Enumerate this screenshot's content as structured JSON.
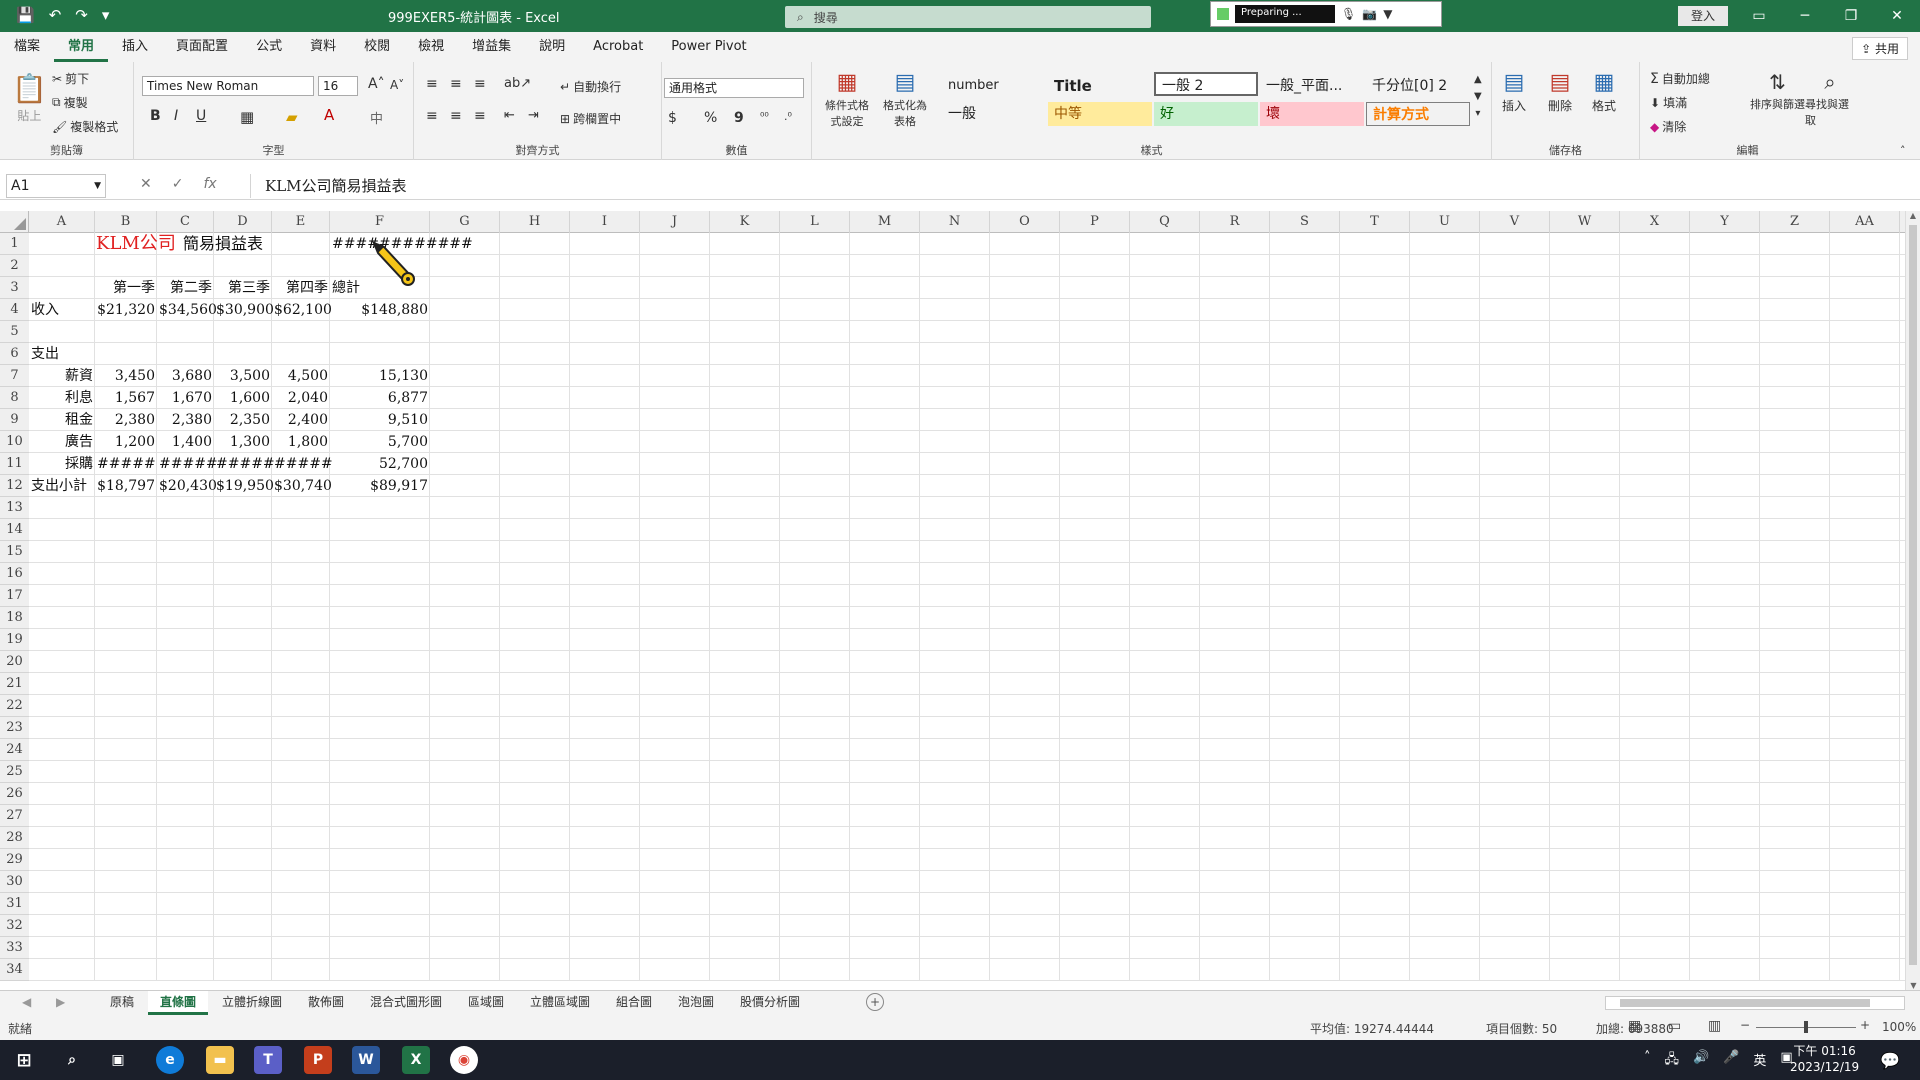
{
  "app": {
    "doc_title": "999EXER5-統計圖表 - Excel",
    "search_placeholder": "搜尋",
    "preparing": "Preparing ...",
    "login": "登入",
    "share": "共用"
  },
  "tabs": [
    "檔案",
    "常用",
    "插入",
    "頁面配置",
    "公式",
    "資料",
    "校閱",
    "檢視",
    "增益集",
    "說明",
    "Acrobat",
    "Power Pivot"
  ],
  "ribbon": {
    "clipboard": {
      "label": "剪貼簿",
      "paste": "貼上",
      "cut": "剪下",
      "copy": "複製",
      "format_painter": "複製格式"
    },
    "font": {
      "label": "字型",
      "font_name": "Times New Roman",
      "font_size": "16",
      "bold": "B",
      "italic": "I",
      "underline": "U"
    },
    "align": {
      "label": "對齊方式",
      "wrap": "自動換行",
      "merge": "跨欄置中"
    },
    "number": {
      "label": "數值",
      "format": "通用格式",
      "currency": "$",
      "percent": "%",
      "comma": "9"
    },
    "styles": {
      "label": "樣式",
      "cond_format": "條件式格式設定",
      "format_table": "格式化為表格",
      "cells": [
        "number",
        "Title",
        "一般 2",
        "一般_平面...",
        "千分位[0] 2",
        "一般",
        "中等",
        "好",
        "壞",
        "計算方式"
      ]
    },
    "cells": {
      "label": "儲存格",
      "insert": "插入",
      "delete": "刪除",
      "format": "格式"
    },
    "editing": {
      "label": "編輯",
      "autosum": "自動加總",
      "fill": "填滿",
      "clear": "清除",
      "sort": "排序與篩選",
      "find": "尋找與選取"
    }
  },
  "formula": {
    "name_box": "A1",
    "content": "KLM公司簡易損益表"
  },
  "columns": [
    "A",
    "B",
    "C",
    "D",
    "E",
    "F",
    "G",
    "H",
    "I",
    "J",
    "K",
    "L",
    "M",
    "N",
    "O",
    "P",
    "Q",
    "R",
    "S",
    "T",
    "U",
    "V",
    "W",
    "X",
    "Y",
    "Z",
    "AA"
  ],
  "rows": [
    "1",
    "2",
    "3",
    "4",
    "5",
    "6",
    "7",
    "8",
    "9",
    "10",
    "11",
    "12",
    "13",
    "14",
    "15",
    "16",
    "17",
    "18",
    "19",
    "20",
    "21",
    "22",
    "23",
    "24",
    "25",
    "26",
    "27",
    "28",
    "29",
    "30",
    "31",
    "32",
    "33",
    "34"
  ],
  "sheet": {
    "title_company": "KLM公司",
    "title_rest": "簡易損益表",
    "date_hash": "############",
    "headers": [
      "第一季",
      "第二季",
      "第三季",
      "第四季",
      "總計"
    ],
    "revenue": {
      "label": "收入",
      "values": [
        "$21,320",
        "$34,560",
        "$30,900",
        "$62,100",
        "$148,880"
      ]
    },
    "expense_label": "支出",
    "expenses": [
      {
        "label": "薪資",
        "values": [
          "3,450",
          "3,680",
          "3,500",
          "4,500",
          "15,130"
        ]
      },
      {
        "label": "利息",
        "values": [
          "1,567",
          "1,670",
          "1,600",
          "2,040",
          "6,877"
        ]
      },
      {
        "label": "租金",
        "values": [
          "2,380",
          "2,380",
          "2,350",
          "2,400",
          "9,510"
        ]
      },
      {
        "label": "廣告",
        "values": [
          "1,200",
          "1,400",
          "1,300",
          "1,800",
          "5,700"
        ]
      },
      {
        "label": "採購",
        "values": [
          "#####",
          "#####",
          "#####",
          "#####",
          "52,700"
        ]
      }
    ],
    "subtotal": {
      "label": "支出小計",
      "values": [
        "$18,797",
        "$20,430",
        "$19,950",
        "$30,740",
        "$89,917"
      ]
    }
  },
  "sheet_tabs": [
    "原稿",
    "直條圖",
    "立體折線圖",
    "散佈圖",
    "混合式圖形圖",
    "區域圖",
    "立體區域圖",
    "組合圖",
    "泡泡圖",
    "股價分析圖"
  ],
  "status": {
    "ready": "就緒",
    "average": "平均值: 19274.44444",
    "count": "項目個數: 50",
    "sum": "加總: 693880",
    "zoom": "100%"
  },
  "taskbar": {
    "time": "下午 01:16",
    "date": "2023/12/19",
    "ime": "英"
  }
}
